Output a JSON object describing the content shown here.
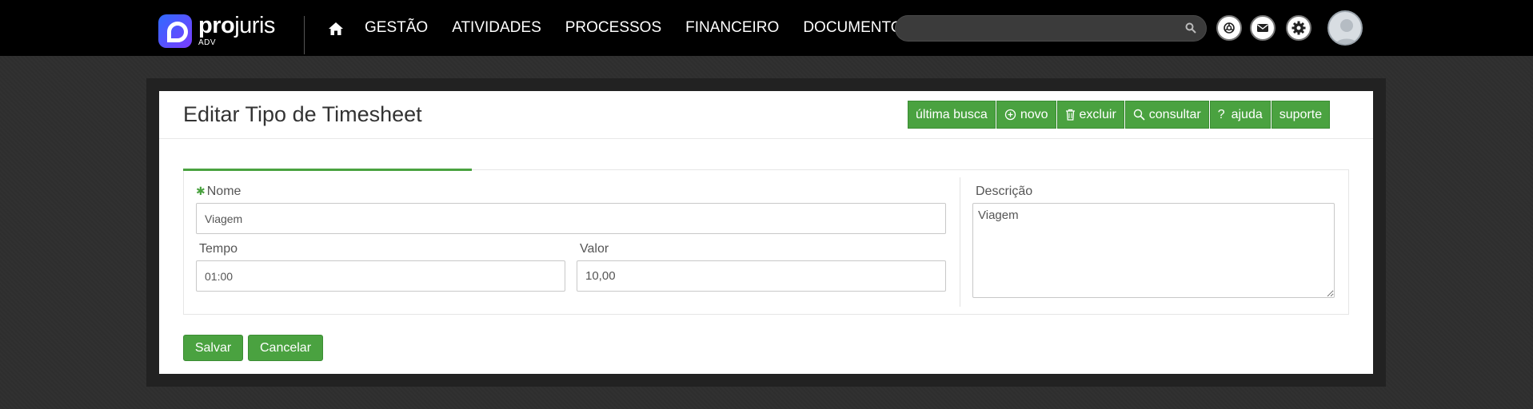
{
  "brand": {
    "name_bold": "pro",
    "name_rest": "juris",
    "sub": "ADV"
  },
  "nav": {
    "items": [
      "GESTÃO",
      "ATIVIDADES",
      "PROCESSOS",
      "FINANCEIRO",
      "DOCUMENTOS"
    ]
  },
  "search": {
    "placeholder": ""
  },
  "page": {
    "title": "Editar Tipo de Timesheet"
  },
  "toolbar": {
    "ultima_busca": "última busca",
    "novo": "novo",
    "excluir": "excluir",
    "consultar": "consultar",
    "ajuda": "ajuda",
    "suporte": "suporte"
  },
  "form": {
    "nome": {
      "label": "Nome",
      "value": "Viagem"
    },
    "tempo": {
      "label": "Tempo",
      "value": "01:00"
    },
    "valor": {
      "label": "Valor",
      "value": "10,00"
    },
    "descricao": {
      "label": "Descrição",
      "value": "Viagem"
    }
  },
  "actions": {
    "save": "Salvar",
    "cancel": "Cancelar"
  },
  "colors": {
    "accent": "#4aa240",
    "topbar": "#000000"
  }
}
